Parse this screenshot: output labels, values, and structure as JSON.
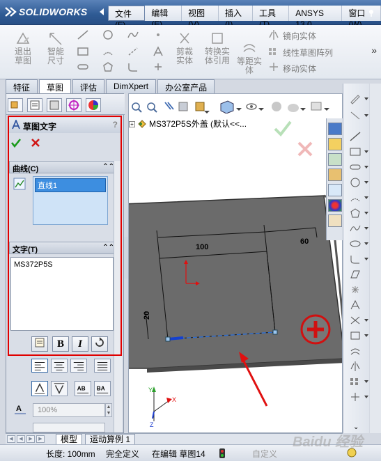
{
  "app": {
    "name": "SOLIDWORKS"
  },
  "menu": [
    "文件(F)",
    "编辑(E)",
    "视图(V)",
    "插入(I)",
    "工具(T)",
    "ANSYS 13.0",
    "窗口(W)"
  ],
  "cmd": {
    "exit_sketch": "退出草图",
    "smart_dim": "智能尺寸",
    "trim": "剪裁实体",
    "convert": "转换实体引用",
    "offset": "等距实体",
    "mirror": "镜向实体",
    "linear_pattern": "线性草图阵列",
    "move": "移动实体"
  },
  "tabs": [
    "特征",
    "草图",
    "评估",
    "DimXpert",
    "办公室产品"
  ],
  "property_manager": {
    "title": "草图文字",
    "help": "?",
    "curves_label": "曲线(C)",
    "curve_item": "直线1",
    "text_label": "文字(T)",
    "text_value": "MS372P5S",
    "width_pct": "100%"
  },
  "tree": {
    "root": "MS372P5S外盖 (默认<<..."
  },
  "drawing": {
    "dim_horizontal": "100",
    "dim_right": "60",
    "dim_vertical": "20"
  },
  "bottom_tabs": [
    "模型",
    "运动算例 1"
  ],
  "status": {
    "length": "长度: 100mm",
    "state": "完全定义",
    "editing": "在编辑 草图14",
    "custom": "自定义"
  },
  "watermark": "Baidu 经验",
  "colors": {
    "highlight_box": "#e00000",
    "accent": "#2e5a94",
    "arrow": "#e01010"
  }
}
